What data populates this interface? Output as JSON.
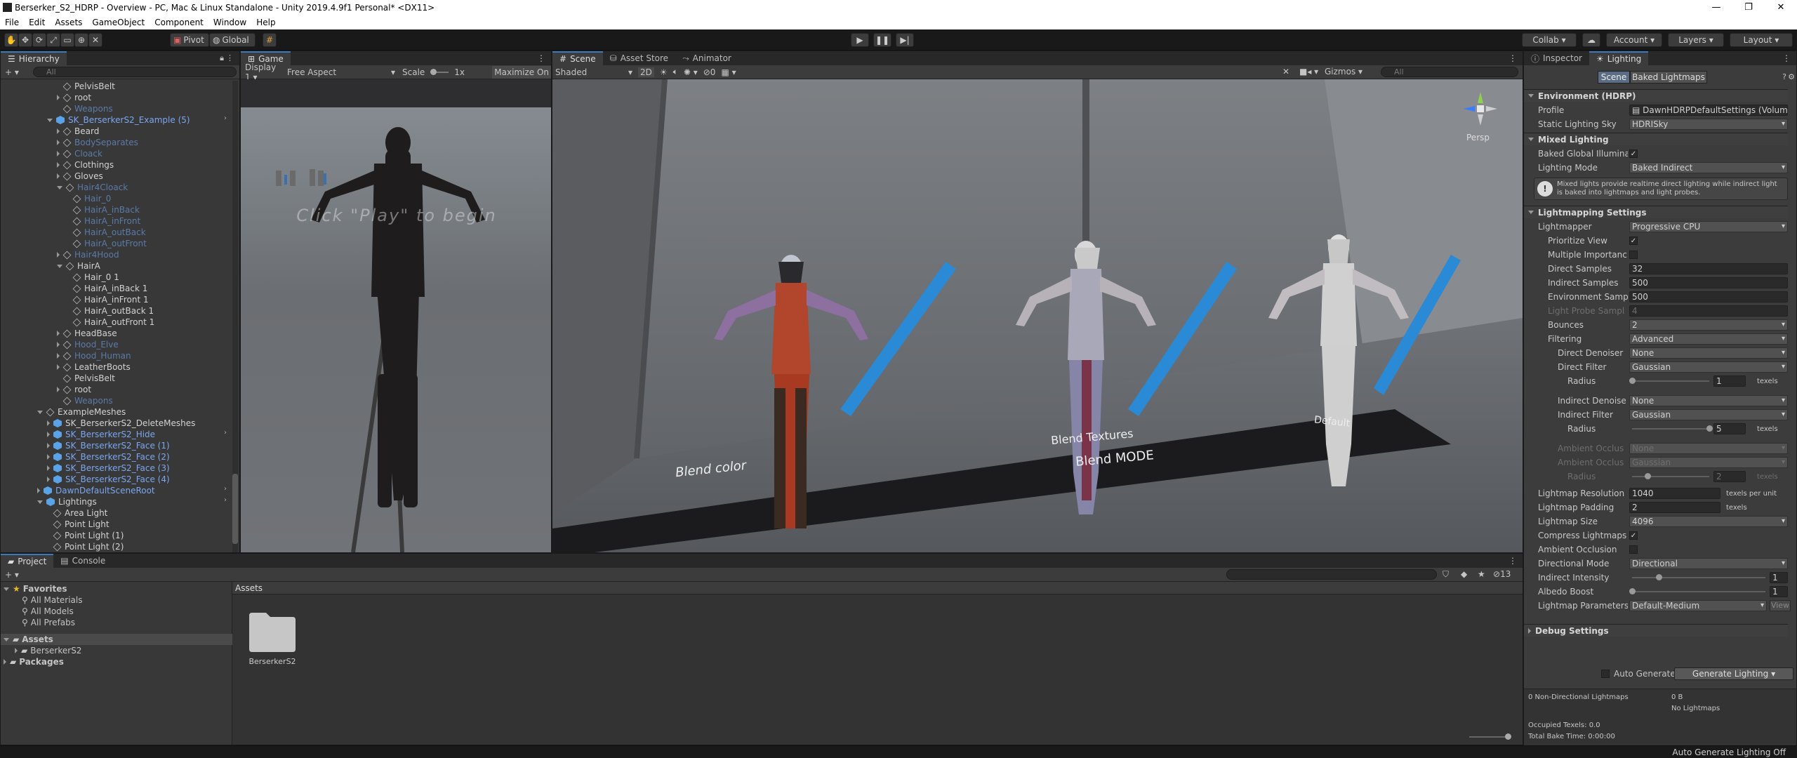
{
  "window": {
    "title": "Berserker_S2_HDRP - Overview - PC, Mac & Linux Standalone - Unity 2019.4.9f1 Personal* <DX11>"
  },
  "menu": [
    "File",
    "Edit",
    "Assets",
    "GameObject",
    "Component",
    "Window",
    "Help"
  ],
  "toolbar": {
    "pivot": "Pivot",
    "global": "Global",
    "collab": "Collab ▾",
    "account": "Account",
    "layers": "Layers",
    "layout": "Layout"
  },
  "hierarchy": {
    "tab": "Hierarchy",
    "search": "All",
    "rows": [
      {
        "t": "PelvisBelt",
        "d": 1,
        "c": "w",
        "a": "none"
      },
      {
        "t": "root",
        "d": 1,
        "c": "w",
        "a": "closed"
      },
      {
        "t": "Weapons",
        "d": 1,
        "c": "d",
        "a": "none"
      },
      {
        "t": "SK_BerserkerS2_Example (5)",
        "d": 0,
        "c": "b",
        "a": "open",
        "p": true,
        "arrow": true
      },
      {
        "t": "Beard",
        "d": 1,
        "c": "w",
        "a": "closed"
      },
      {
        "t": "BodySeparates",
        "d": 1,
        "c": "d",
        "a": "closed"
      },
      {
        "t": "Cloack",
        "d": 1,
        "c": "d",
        "a": "closed"
      },
      {
        "t": "Clothings",
        "d": 1,
        "c": "w",
        "a": "closed"
      },
      {
        "t": "Gloves",
        "d": 1,
        "c": "w",
        "a": "closed"
      },
      {
        "t": "Hair4Cloack",
        "d": 1,
        "c": "d",
        "a": "open"
      },
      {
        "t": "Hair_0",
        "d": 2,
        "c": "d",
        "a": "none"
      },
      {
        "t": "HairA_inBack",
        "d": 2,
        "c": "d",
        "a": "none"
      },
      {
        "t": "HairA_inFront",
        "d": 2,
        "c": "d",
        "a": "none"
      },
      {
        "t": "HairA_outBack",
        "d": 2,
        "c": "d",
        "a": "none"
      },
      {
        "t": "HairA_outFront",
        "d": 2,
        "c": "d",
        "a": "none"
      },
      {
        "t": "Hair4Hood",
        "d": 1,
        "c": "d",
        "a": "closed"
      },
      {
        "t": "HairA",
        "d": 1,
        "c": "w",
        "a": "open"
      },
      {
        "t": "Hair_0 1",
        "d": 2,
        "c": "w",
        "a": "none"
      },
      {
        "t": "HairA_inBack 1",
        "d": 2,
        "c": "w",
        "a": "none"
      },
      {
        "t": "HairA_inFront 1",
        "d": 2,
        "c": "w",
        "a": "none"
      },
      {
        "t": "HairA_outBack 1",
        "d": 2,
        "c": "w",
        "a": "none"
      },
      {
        "t": "HairA_outFront 1",
        "d": 2,
        "c": "w",
        "a": "none"
      },
      {
        "t": "HeadBase",
        "d": 1,
        "c": "w",
        "a": "closed"
      },
      {
        "t": "Hood_Elve",
        "d": 1,
        "c": "d",
        "a": "closed"
      },
      {
        "t": "Hood_Human",
        "d": 1,
        "c": "d",
        "a": "closed"
      },
      {
        "t": "LeatherBoots",
        "d": 1,
        "c": "w",
        "a": "closed"
      },
      {
        "t": "PelvisBelt",
        "d": 1,
        "c": "w",
        "a": "none"
      },
      {
        "t": "root",
        "d": 1,
        "c": "w",
        "a": "closed"
      },
      {
        "t": "Weapons",
        "d": 1,
        "c": "d",
        "a": "none"
      },
      {
        "t": "ExampleMeshes",
        "d": -1,
        "c": "w",
        "a": "open"
      },
      {
        "t": "SK_BerserkerS2_DeleteMeshes",
        "d": 0,
        "c": "w",
        "a": "closed",
        "p": true
      },
      {
        "t": "SK_BerserkerS2_Hide",
        "d": 0,
        "c": "b",
        "a": "closed",
        "p": true,
        "arrow": true
      },
      {
        "t": "SK_BerserkerS2_Face (1)",
        "d": 0,
        "c": "b",
        "a": "closed",
        "p": true
      },
      {
        "t": "SK_BerserkerS2_Face (2)",
        "d": 0,
        "c": "b",
        "a": "closed",
        "p": true
      },
      {
        "t": "SK_BerserkerS2_Face (3)",
        "d": 0,
        "c": "b",
        "a": "closed",
        "p": true
      },
      {
        "t": "SK_BerserkerS2_Face (4)",
        "d": 0,
        "c": "b",
        "a": "closed",
        "p": true
      },
      {
        "t": "DawnDefaultSceneRoot",
        "d": -1,
        "c": "b",
        "a": "closed",
        "p": true,
        "arrow": true
      },
      {
        "t": "Lightings",
        "d": -1,
        "c": "w",
        "a": "open",
        "p": true,
        "arrow": true
      },
      {
        "t": "Area Light",
        "d": 0,
        "c": "w",
        "a": "none"
      },
      {
        "t": "Point Light",
        "d": 0,
        "c": "w",
        "a": "none"
      },
      {
        "t": "Point Light (1)",
        "d": 0,
        "c": "w",
        "a": "none"
      },
      {
        "t": "Point Light (2)",
        "d": 0,
        "c": "w",
        "a": "none"
      }
    ]
  },
  "game": {
    "tab": "Game",
    "display": "Display 1",
    "aspect": "Free Aspect",
    "scale_label": "Scale",
    "scale": "1x",
    "maximize": "Maximize On",
    "overlay": "Click \"Play\" to begin"
  },
  "scene": {
    "tabs": [
      "Scene",
      "Asset Store",
      "Animator"
    ],
    "shading": "Shaded",
    "mode2d": "2D",
    "gizmos": "Gizmos",
    "search": "All",
    "persp": "Persp",
    "labels": [
      "Blend color",
      "Blend Textures",
      "Blend MODE",
      "Default"
    ]
  },
  "project": {
    "tabs": [
      "Project",
      "Console"
    ],
    "favorites": "Favorites",
    "fav_items": [
      "All Materials",
      "All Models",
      "All Prefabs"
    ],
    "assets": "Assets",
    "asset_children": [
      "BerserkerS2"
    ],
    "packages": "Packages",
    "breadcrumb": "Assets",
    "folder": "BerserkerS2",
    "count": "13"
  },
  "inspector": {
    "tabs": [
      "Inspector",
      "Lighting"
    ],
    "subtabs": [
      "Scene",
      "Baked Lightmaps"
    ],
    "env": "Environment (HDRP)",
    "profile_lbl": "Profile",
    "profile": "DawnHDRPDefaultSettings (VolumeP",
    "sky_lbl": "Static Lighting Sky",
    "sky": "HDRISky",
    "mixed": "Mixed Lighting",
    "bgi_lbl": "Baked Global Illumina",
    "mode_lbl": "Lighting Mode",
    "mode": "Baked Indirect",
    "help": "Mixed lights provide realtime direct lighting while indirect light is baked into lightmaps and light probes.",
    "lm": "Lightmapping Settings",
    "rows": {
      "lightmapper": [
        "Lightmapper",
        "Progressive CPU"
      ],
      "prioritize": [
        "Prioritize View"
      ],
      "multi": [
        "Multiple Importanc"
      ],
      "direct": [
        "Direct Samples",
        "32"
      ],
      "indirect": [
        "Indirect Samples",
        "500"
      ],
      "envs": [
        "Environment Samp",
        "500"
      ],
      "probe": [
        "Light Probe Sampl",
        "4"
      ],
      "bounces": [
        "Bounces",
        "2"
      ],
      "filtering": [
        "Filtering",
        "Advanced"
      ],
      "dden": [
        "Direct Denoiser",
        "None"
      ],
      "dfil": [
        "Direct Filter",
        "Gaussian"
      ],
      "drad": [
        "Radius",
        "1",
        "texels"
      ],
      "iden": [
        "Indirect Denoise",
        "None"
      ],
      "ifil": [
        "Indirect Filter",
        "Gaussian"
      ],
      "irad": [
        "Radius",
        "5",
        "texels"
      ],
      "aoden": [
        "Ambient Occlus",
        "None"
      ],
      "aofil": [
        "Ambient Occlus",
        "Gaussian"
      ],
      "aorad": [
        "Radius",
        "2",
        "texels"
      ],
      "res": [
        "Lightmap Resolution",
        "1040",
        "texels per unit"
      ],
      "pad": [
        "Lightmap Padding",
        "2",
        "texels"
      ],
      "size": [
        "Lightmap Size",
        "4096"
      ],
      "compress": [
        "Compress Lightmaps"
      ],
      "ao": [
        "Ambient Occlusion"
      ],
      "dirmode": [
        "Directional Mode",
        "Directional"
      ],
      "intensity": [
        "Indirect Intensity",
        "1"
      ],
      "albedo": [
        "Albedo Boost",
        "1"
      ],
      "params": [
        "Lightmap Parameters",
        "Default-Medium",
        "View"
      ]
    },
    "debug": "Debug Settings",
    "auto": "Auto Generate",
    "generate": "Generate Lighting",
    "stats": [
      "0 Non-Directional Lightmaps",
      "0 B",
      "No Lightmaps",
      "Occupied Texels: 0.0",
      "Total Bake Time: 0:00:00"
    ]
  },
  "status": "Auto Generate Lighting Off"
}
